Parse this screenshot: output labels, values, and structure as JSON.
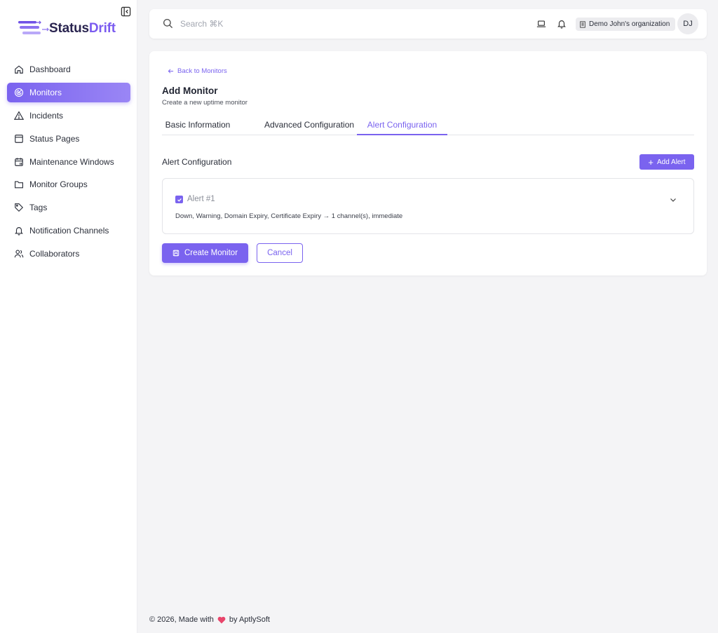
{
  "sidebar": {
    "logo": {
      "part1": "Status",
      "part2": "Drift"
    },
    "items": [
      {
        "label": "Dashboard",
        "icon": "home-icon"
      },
      {
        "label": "Monitors",
        "icon": "radar-icon",
        "active": true
      },
      {
        "label": "Incidents",
        "icon": "warning-icon"
      },
      {
        "label": "Status Pages",
        "icon": "window-icon"
      },
      {
        "label": "Maintenance Windows",
        "icon": "calendar-icon"
      },
      {
        "label": "Monitor Groups",
        "icon": "folder-icon"
      },
      {
        "label": "Tags",
        "icon": "tag-icon"
      },
      {
        "label": "Notification Channels",
        "icon": "bell-icon"
      },
      {
        "label": "Collaborators",
        "icon": "users-icon"
      }
    ]
  },
  "topbar": {
    "search_placeholder": "Search ⌘K",
    "organization": "Demo John's organization",
    "avatar_initials": "DJ"
  },
  "page": {
    "back_link": "Back to Monitors",
    "title": "Add Monitor",
    "subtitle": "Create a new uptime monitor",
    "tabs": [
      {
        "label": "Basic Information"
      },
      {
        "label": "Advanced Configuration"
      },
      {
        "label": "Alert Configuration",
        "active": true
      }
    ],
    "section_label": "Alert Configuration",
    "add_alert_label": "Add Alert",
    "alert": {
      "title": "Alert #1",
      "checked": true,
      "summary": "Down, Warning, Domain Expiry, Certificate Expiry → 1 channel(s), immediate"
    },
    "create_label": "Create Monitor",
    "cancel_label": "Cancel"
  },
  "footer": {
    "prefix": "© 2026, Made with",
    "suffix": "by AptlySoft"
  },
  "colors": {
    "accent": "#7a63ef",
    "background": "#f4f4f6",
    "heart": "#e8456b"
  }
}
